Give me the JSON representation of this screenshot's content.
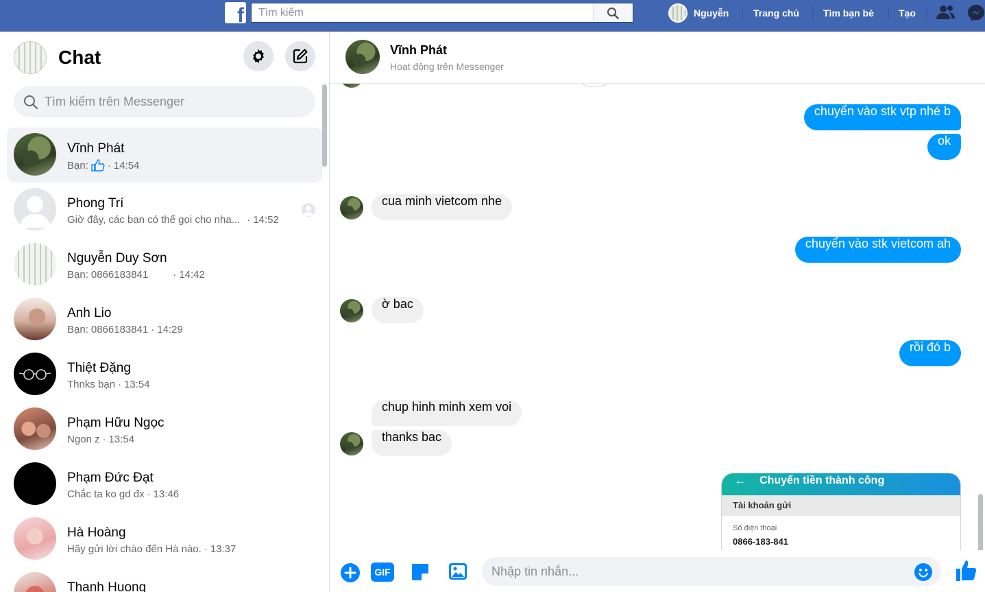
{
  "topbar": {
    "logo_letter": "f",
    "search_placeholder": "Tìm kiếm",
    "user_name": "Nguyễn",
    "nav_home": "Trang chủ",
    "nav_friends": "Tìm bạn bè",
    "nav_create": "Tạo"
  },
  "sidebar": {
    "title": "Chat",
    "search_placeholder": "Tìm kiếm trên Messenger",
    "conversations": [
      {
        "name": "Vĩnh Phát",
        "prefix": "Bạn:",
        "preview": "",
        "time": "14:54",
        "like": true
      },
      {
        "name": "Phong Trí",
        "prefix": "",
        "preview": "Giờ đây, các bạn có thể gọi cho nha...",
        "time": "14:52"
      },
      {
        "name": "Nguyễn Duy Sơn",
        "prefix": "Bạn:",
        "preview": "0866183841",
        "time": "14:42"
      },
      {
        "name": "Anh Lio",
        "prefix": "Bạn:",
        "preview": "0866183841",
        "time": "14:29"
      },
      {
        "name": "Thiệt Đặng",
        "prefix": "",
        "preview": "Thnks bạn",
        "time": "13:54"
      },
      {
        "name": "Phạm Hữu Ngọc",
        "prefix": "",
        "preview": "Ngon z",
        "time": "13:54"
      },
      {
        "name": "Phạm Đức Đạt",
        "prefix": "",
        "preview": "Chắc ta ko gd đx",
        "time": "13:46"
      },
      {
        "name": "Hà Hoàng",
        "prefix": "",
        "preview": "Hãy gửi lời chào đến Hà nào.",
        "time": "13:37"
      },
      {
        "name": "Thanh Huong",
        "prefix": "",
        "preview": "",
        "time": ""
      }
    ]
  },
  "conversation": {
    "name": "Vĩnh Phát",
    "status": "Hoạt động trên Messenger",
    "messages": [
      {
        "dir": "out",
        "text": "chuyển vào stk vtp nhé b"
      },
      {
        "dir": "out",
        "text": "ok"
      },
      {
        "dir": "in",
        "text": "cua minh vietcom nhe"
      },
      {
        "dir": "out",
        "text": "chuyển vào stk vietcom ah"
      },
      {
        "dir": "in",
        "text": "ờ bac"
      },
      {
        "dir": "out",
        "text": "rồi đó b"
      },
      {
        "dir": "in",
        "text": "chup hinh minh xem voi"
      },
      {
        "dir": "in",
        "text": "thanks bac"
      }
    ],
    "screenshot": {
      "title": "Chuyển tiền thành công",
      "section": "Tài khoản gửi",
      "label": "Số điện thoại",
      "value": "0866-183-841"
    },
    "composer_placeholder": "Nhập tin nhắn...",
    "gif_label": "GIF"
  },
  "colors": {
    "topbar": "#4267b2",
    "outgoing_bubble": "#0099ff",
    "incoming_bubble": "#f0f0f0",
    "accent": "#0084ff"
  }
}
